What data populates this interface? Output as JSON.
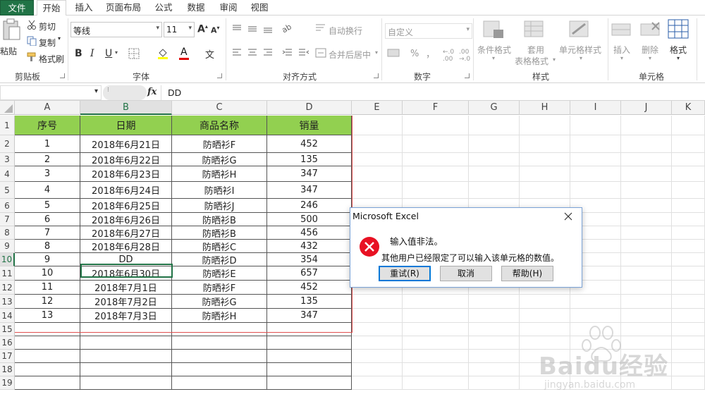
{
  "tabs": {
    "file": "文件",
    "home": "开始",
    "insert": "插入",
    "page_layout": "页面布局",
    "formulas": "公式",
    "data": "数据",
    "review": "审阅",
    "view": "视图"
  },
  "ribbon": {
    "paste": "粘贴",
    "cut": "剪切",
    "copy": "复制",
    "format_painter": "格式刷",
    "clipboard": "剪贴板",
    "font_name": "等线",
    "font_size": "11",
    "bold": "B",
    "italic": "I",
    "underline": "U",
    "font_color": "A",
    "wen": "文",
    "font_group": "字体",
    "wrap_text": "自动换行",
    "merge_center": "合并后居中",
    "alignment_group": "对齐方式",
    "number_format": "自定义",
    "percent": "%",
    "comma": "，",
    "number_group": "数字",
    "conditional_format": "条件格式",
    "table_format_1": "套用",
    "table_format_2": "表格格式",
    "cell_styles": "单元格样式",
    "styles_group": "样式",
    "insert": "插入",
    "delete": "删除",
    "format": "格式",
    "cells_group": "单元格"
  },
  "formula_bar": {
    "fx": "fx",
    "content": "DD"
  },
  "columns": [
    "A",
    "B",
    "C",
    "D",
    "E",
    "F",
    "G",
    "H",
    "I",
    "J",
    "K"
  ],
  "table": {
    "headers": [
      "序号",
      "日期",
      "商品名称",
      "销量"
    ],
    "rows": [
      [
        "1",
        "2018年6月21日",
        "防晒衫F",
        "452"
      ],
      [
        "2",
        "2018年6月22日",
        "防晒衫G",
        "135"
      ],
      [
        "3",
        "2018年6月23日",
        "防晒衫H",
        "347"
      ],
      [
        "4",
        "2018年6月24日",
        "防晒衫I",
        "347"
      ],
      [
        "5",
        "2018年6月25日",
        "防晒衫J",
        "246"
      ],
      [
        "6",
        "2018年6月26日",
        "防晒衫B",
        "500"
      ],
      [
        "7",
        "2018年6月27日",
        "防晒衫B",
        "456"
      ],
      [
        "8",
        "2018年6月28日",
        "防晒衫C",
        "432"
      ],
      [
        "9",
        "DD",
        "防晒衫D",
        "354"
      ],
      [
        "10",
        "2018年6月30日",
        "防晒衫E",
        "657"
      ],
      [
        "11",
        "2018年7月1日",
        "防晒衫F",
        "452"
      ],
      [
        "12",
        "2018年7月2日",
        "防晒衫G",
        "135"
      ],
      [
        "13",
        "2018年7月3日",
        "防晒衫H",
        "347"
      ]
    ]
  },
  "row_numbers": [
    "1",
    "2",
    "3",
    "4",
    "5",
    "6",
    "7",
    "8",
    "9",
    "10",
    "11",
    "12",
    "13",
    "14",
    "15",
    "16",
    "17",
    "18",
    "19"
  ],
  "dialog": {
    "title": "Microsoft Excel",
    "message": "输入值非法。",
    "detail": "其他用户已经限定了可以输入该单元格的数值。",
    "retry": "重试(R)",
    "cancel": "取消",
    "help": "帮助(H)"
  },
  "watermark": {
    "brand": "Baidu经验",
    "url": "jingyan.baidu.com"
  },
  "colors": {
    "excel_green": "#217346",
    "header_fill": "#92d050",
    "error_red": "#e81123"
  }
}
